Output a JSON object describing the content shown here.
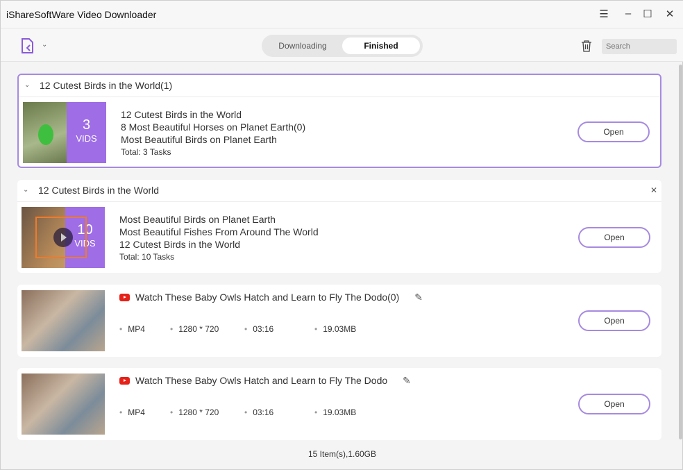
{
  "app": {
    "title": "iShareSoftWare Video Downloader"
  },
  "toolbar": {
    "tabs": [
      "Downloading",
      "Finished"
    ],
    "active_tab": "Finished",
    "search_placeholder": "Search"
  },
  "groups": [
    {
      "title": "12 Cutest Birds in the World(1)",
      "count": "3",
      "count_label": "VIDS",
      "items": [
        "12 Cutest Birds in the World",
        "8 Most Beautiful Horses on Planet Earth(0)",
        "Most Beautiful Birds on Planet Earth"
      ],
      "total": "Total: 3 Tasks",
      "open": "Open"
    },
    {
      "title": "12 Cutest Birds in the World",
      "count": "10",
      "count_label": "VIDS",
      "items": [
        "Most Beautiful Birds on Planet Earth",
        "Most Beautiful Fishes From Around The World",
        "12 Cutest Birds in the World"
      ],
      "total": "Total: 10 Tasks",
      "open": "Open"
    }
  ],
  "videos": [
    {
      "title": "Watch These Baby Owls Hatch and Learn to Fly  The Dodo(0)",
      "format": "MP4",
      "resolution": "1280 * 720",
      "duration": "03:16",
      "size": "19.03MB",
      "open": "Open"
    },
    {
      "title": "Watch These Baby Owls Hatch and Learn to Fly  The Dodo",
      "format": "MP4",
      "resolution": "1280 * 720",
      "duration": "03:16",
      "size": "19.03MB",
      "open": "Open"
    }
  ],
  "footer": {
    "summary": "15 Item(s),1.60GB"
  },
  "colors": {
    "accent": "#9f6de6",
    "youtube": "#e62117"
  }
}
